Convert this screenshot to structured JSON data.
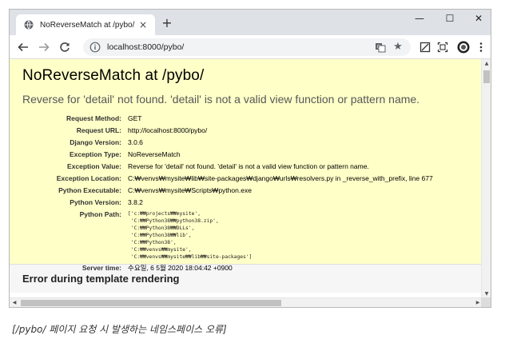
{
  "browser": {
    "tab_title": "NoReverseMatch at /pybo/",
    "tab_close": "×",
    "new_tab": "+",
    "window_controls": {
      "minimize": "—",
      "maximize": "☐",
      "close": "✕"
    },
    "url": "localhost:8000/pybo/"
  },
  "page": {
    "title": "NoReverseMatch at /pybo/",
    "subtitle": "Reverse for 'detail' not found. 'detail' is not a valid view function or pattern name.",
    "meta": [
      {
        "key": "Request Method:",
        "value": "GET"
      },
      {
        "key": "Request URL:",
        "value": "http://localhost:8000/pybo/"
      },
      {
        "key": "Django Version:",
        "value": "3.0.6"
      },
      {
        "key": "Exception Type:",
        "value": "NoReverseMatch"
      },
      {
        "key": "Exception Value:",
        "value": "Reverse for 'detail' not found. 'detail' is not a valid view function or pattern name."
      },
      {
        "key": "Exception Location:",
        "value": "C:₩venvs₩mysite₩lib₩site-packages₩django₩urls₩resolvers.py in _reverse_with_prefix, line 677"
      },
      {
        "key": "Python Executable:",
        "value": "C:₩venvs₩mysite₩Scripts₩python.exe"
      },
      {
        "key": "Python Version:",
        "value": "3.8.2"
      },
      {
        "key": "Python Path:",
        "value": ""
      },
      {
        "key": "Server time:",
        "value": "수요일, 6 5월 2020 18:04:42 +0900"
      }
    ],
    "python_path": [
      "['c:₩₩projects₩₩mysite',",
      " 'C:₩₩Python38₩₩python38.zip',",
      " 'C:₩₩Python38₩₩DLLs',",
      " 'C:₩₩Python38₩₩lib',",
      " 'C:₩₩Python38',",
      " 'C:₩₩venvs₩₩mysite',",
      " 'C:₩₩venvs₩₩mysite₩₩lib₩₩site-packages']"
    ],
    "template_heading": "Error during template rendering"
  },
  "caption": "[/pybo/ 페이지 요청 시 발생하는 네임스페이스 오류]",
  "colors": {
    "summary_bg": "#ffffc8",
    "tabstrip_bg": "#dee1e6"
  },
  "icons": [
    "globe-icon",
    "back-arrow-icon",
    "forward-arrow-icon",
    "reload-icon",
    "info-icon",
    "translate-icon",
    "star-icon",
    "extension-icon",
    "cast-icon",
    "profile-icon",
    "menu-icon"
  ]
}
